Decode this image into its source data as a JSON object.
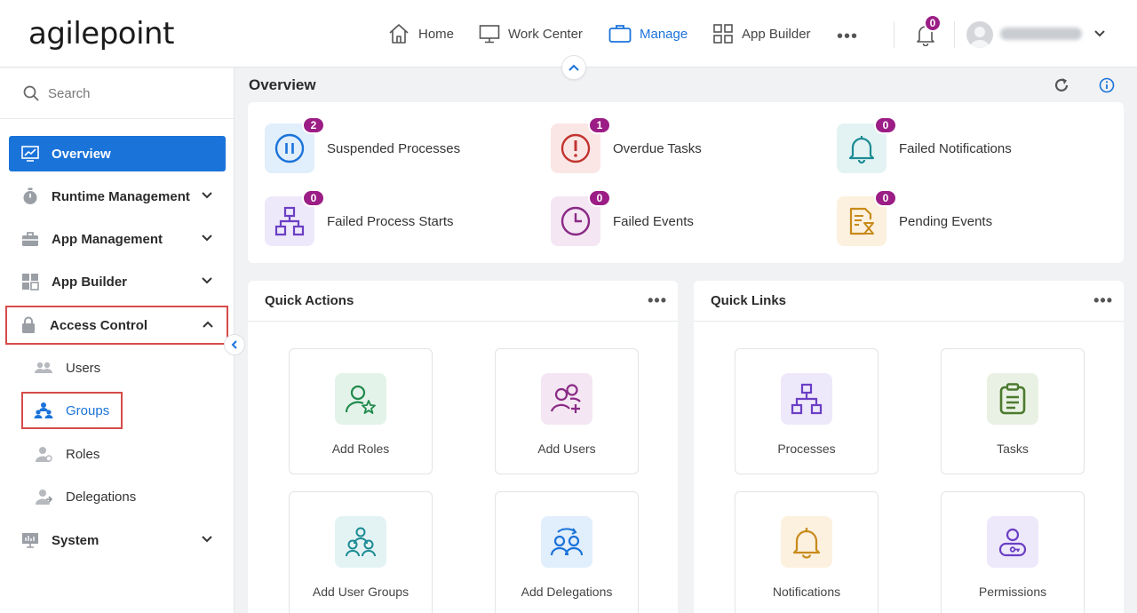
{
  "header": {
    "logo": "agilepoint",
    "nav": [
      {
        "label": "Home",
        "icon": "home-icon"
      },
      {
        "label": "Work Center",
        "icon": "monitor-icon"
      },
      {
        "label": "Manage",
        "icon": "briefcase-icon",
        "active": true
      },
      {
        "label": "App Builder",
        "icon": "grid-icon"
      }
    ],
    "more": "•••",
    "notification_count": "0",
    "accent": "#1a73d9",
    "badge_color": "#9b1d85"
  },
  "sidebar": {
    "search_placeholder": "Search",
    "items": [
      {
        "label": "Overview",
        "icon": "chart-monitor-icon",
        "active": true
      },
      {
        "label": "Runtime Management",
        "icon": "stopwatch-icon"
      },
      {
        "label": "App Management",
        "icon": "toolbox-icon"
      },
      {
        "label": "App Builder",
        "icon": "grid-icon"
      },
      {
        "label": "Access Control",
        "icon": "lock-icon",
        "expanded": true
      },
      {
        "label": "System",
        "icon": "server-icon"
      }
    ],
    "sub_items": [
      {
        "label": "Users",
        "icon": "users-icon"
      },
      {
        "label": "Groups",
        "icon": "groups-icon",
        "active": true
      },
      {
        "label": "Roles",
        "icon": "role-icon"
      },
      {
        "label": "Delegations",
        "icon": "delegation-icon"
      }
    ]
  },
  "overview": {
    "title": "Overview",
    "stats": [
      {
        "label": "Suspended Processes",
        "count": "2",
        "icon": "pause-icon"
      },
      {
        "label": "Overdue Tasks",
        "count": "1",
        "icon": "alert-icon"
      },
      {
        "label": "Failed Notifications",
        "count": "0",
        "icon": "bell-icon"
      },
      {
        "label": "Failed Process Starts",
        "count": "0",
        "icon": "process-icon"
      },
      {
        "label": "Failed Events",
        "count": "0",
        "icon": "clock-icon"
      },
      {
        "label": "Pending Events",
        "count": "0",
        "icon": "hourglass-doc-icon"
      }
    ]
  },
  "quick_actions": {
    "title": "Quick Actions",
    "more": "•••",
    "tiles": [
      {
        "label": "Add Roles",
        "icon": "add-role-icon"
      },
      {
        "label": "Add Users",
        "icon": "add-users-icon"
      },
      {
        "label": "Add User Groups",
        "icon": "user-groups-icon"
      },
      {
        "label": "Add Delegations",
        "icon": "delegations-icon"
      }
    ]
  },
  "quick_links": {
    "title": "Quick Links",
    "more": "•••",
    "tiles": [
      {
        "label": "Processes",
        "icon": "process-icon"
      },
      {
        "label": "Tasks",
        "icon": "clipboard-icon"
      },
      {
        "label": "Notifications",
        "icon": "bell-icon"
      },
      {
        "label": "Permissions",
        "icon": "permission-icon"
      }
    ]
  }
}
